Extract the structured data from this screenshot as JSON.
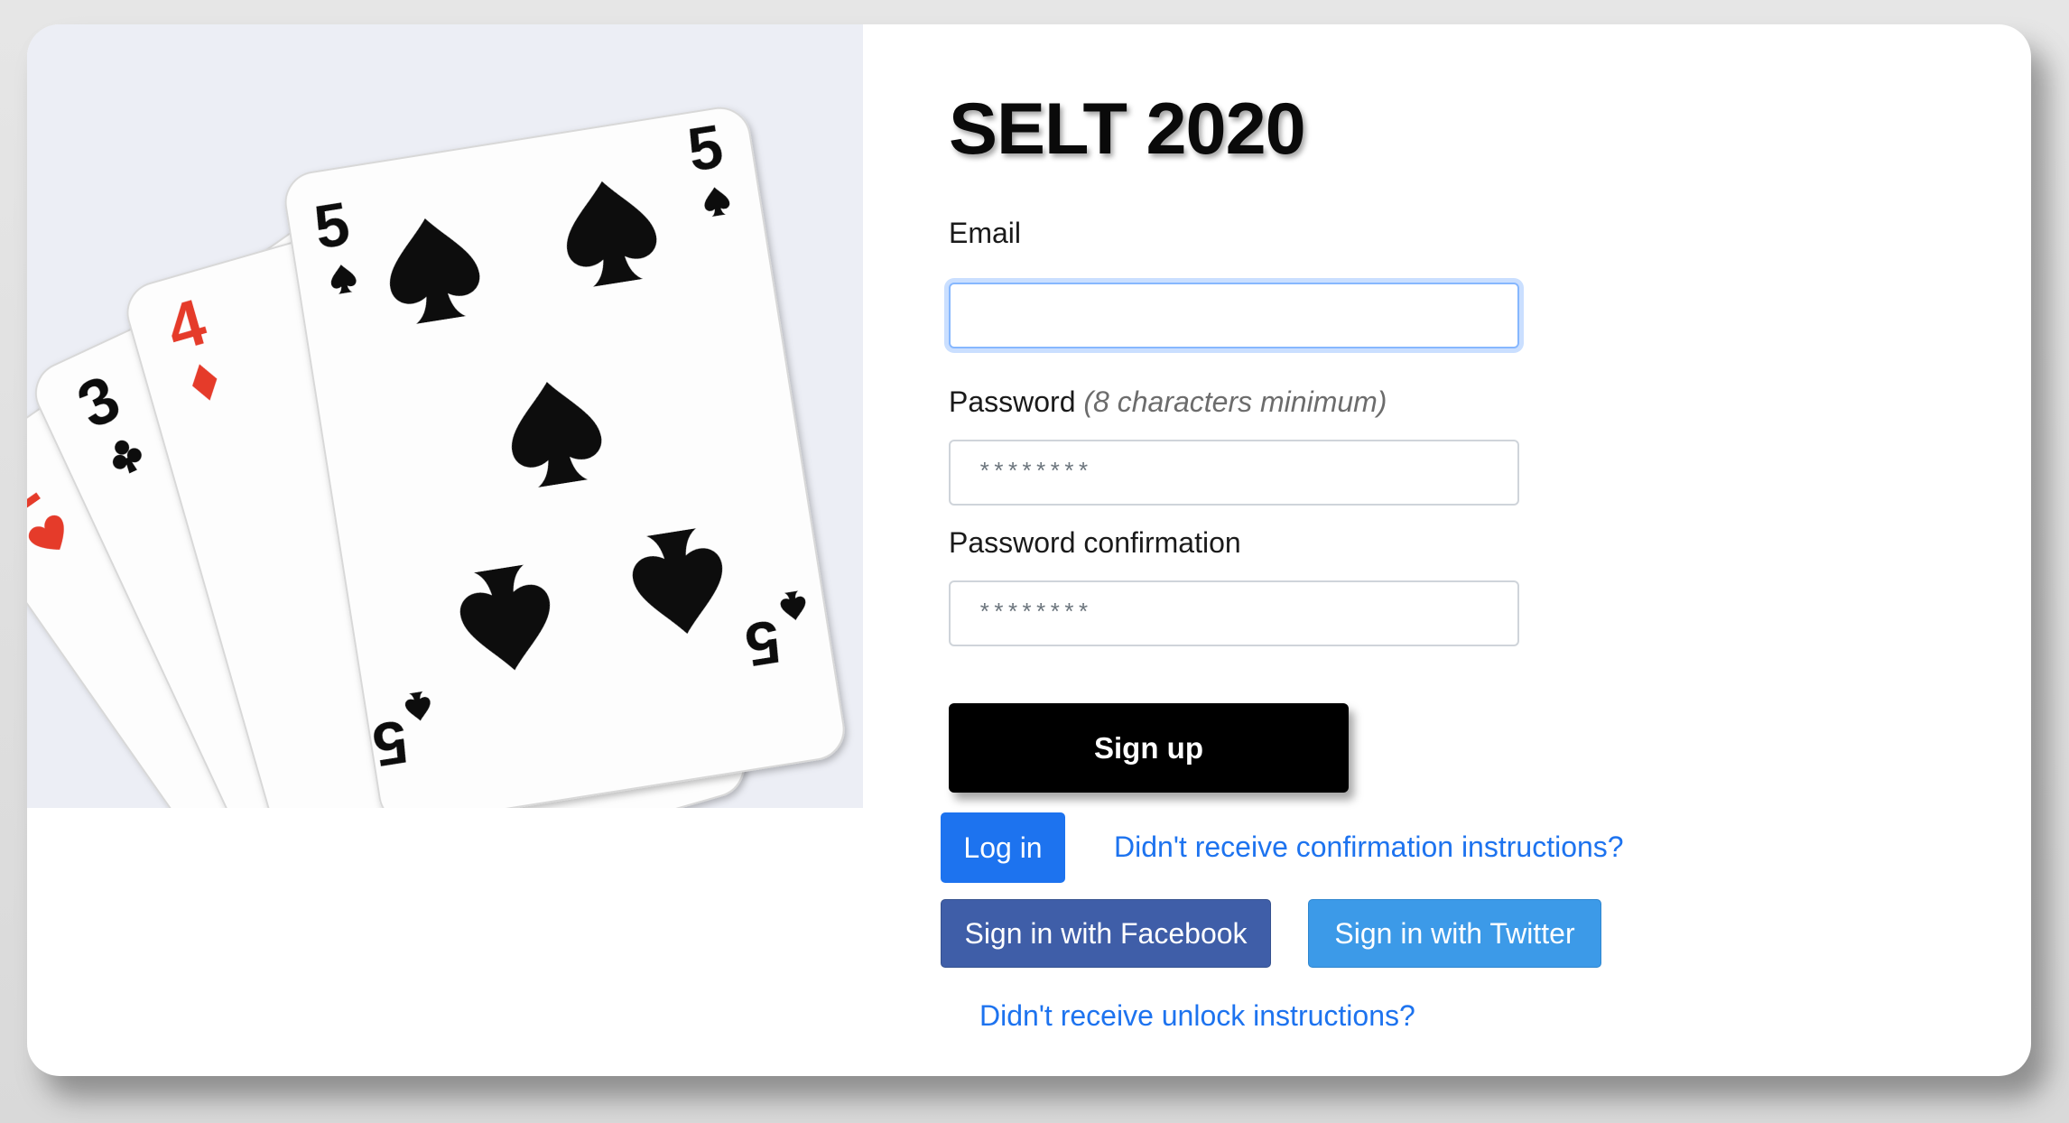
{
  "page": {
    "title": "SELT 2020",
    "hero_image": "playing-cards-2-3-4-5-hand"
  },
  "form": {
    "email_label": "Email",
    "email_value": "",
    "password_label": "Password",
    "password_hint": "(8 characters minimum)",
    "password_placeholder": "********",
    "password_confirmation_label": "Password confirmation",
    "password_confirmation_placeholder": "********",
    "signup_label": "Sign up"
  },
  "links": {
    "login_label": "Log in",
    "confirmation_link": "Didn't receive confirmation instructions?",
    "facebook_label": "Sign in with Facebook",
    "twitter_label": "Sign in with Twitter",
    "unlock_link": "Didn't receive unlock instructions?"
  },
  "colors": {
    "primary": "#1d73ef",
    "facebook": "#3f5ea8",
    "twitter": "#3c9ae8",
    "signup_bg": "#000000",
    "card_red": "#e53b2c"
  }
}
